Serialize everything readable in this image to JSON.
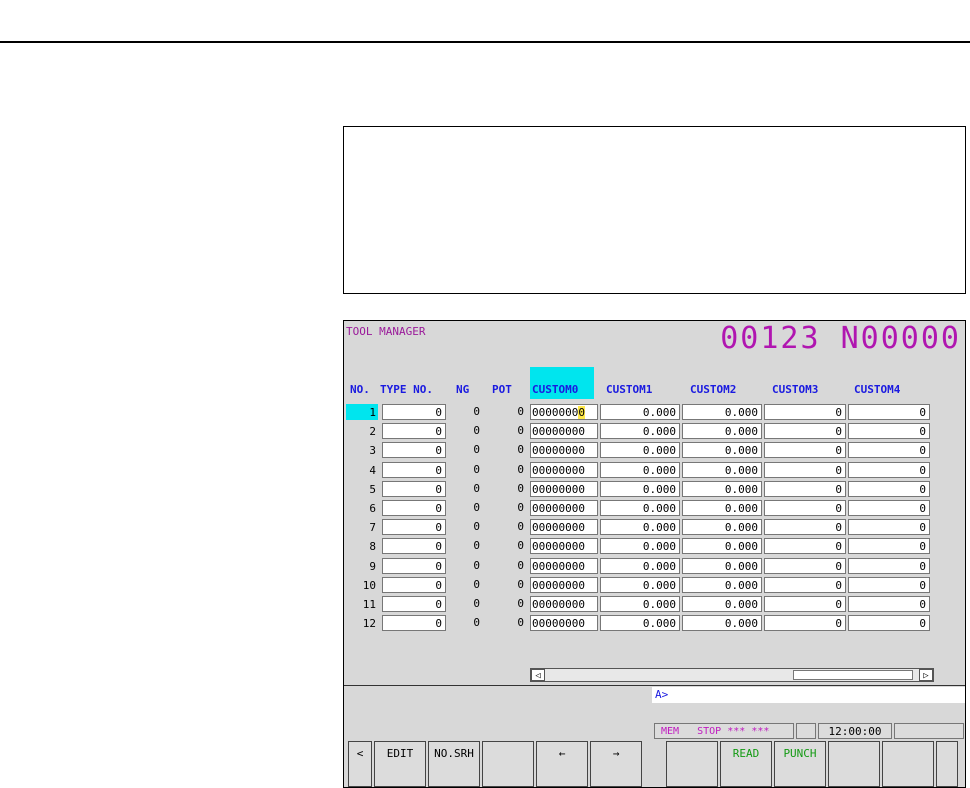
{
  "screen": {
    "title": "TOOL MANAGER",
    "program": "00123 N00000",
    "columns": [
      "NO.",
      "TYPE NO.",
      "NG",
      "POT",
      "CUSTOM0",
      "CUSTOM1",
      "CUSTOM2",
      "CUSTOM3",
      "CUSTOM4"
    ],
    "rows": [
      {
        "no": "1",
        "type": "0",
        "ng": "0",
        "pot": "0",
        "c0": "00000000",
        "c1": "0.000",
        "c2": "0.000",
        "c3": "0",
        "c4": "0"
      },
      {
        "no": "2",
        "type": "0",
        "ng": "0",
        "pot": "0",
        "c0": "00000000",
        "c1": "0.000",
        "c2": "0.000",
        "c3": "0",
        "c4": "0"
      },
      {
        "no": "3",
        "type": "0",
        "ng": "0",
        "pot": "0",
        "c0": "00000000",
        "c1": "0.000",
        "c2": "0.000",
        "c3": "0",
        "c4": "0"
      },
      {
        "no": "4",
        "type": "0",
        "ng": "0",
        "pot": "0",
        "c0": "00000000",
        "c1": "0.000",
        "c2": "0.000",
        "c3": "0",
        "c4": "0"
      },
      {
        "no": "5",
        "type": "0",
        "ng": "0",
        "pot": "0",
        "c0": "00000000",
        "c1": "0.000",
        "c2": "0.000",
        "c3": "0",
        "c4": "0"
      },
      {
        "no": "6",
        "type": "0",
        "ng": "0",
        "pot": "0",
        "c0": "00000000",
        "c1": "0.000",
        "c2": "0.000",
        "c3": "0",
        "c4": "0"
      },
      {
        "no": "7",
        "type": "0",
        "ng": "0",
        "pot": "0",
        "c0": "00000000",
        "c1": "0.000",
        "c2": "0.000",
        "c3": "0",
        "c4": "0"
      },
      {
        "no": "8",
        "type": "0",
        "ng": "0",
        "pot": "0",
        "c0": "00000000",
        "c1": "0.000",
        "c2": "0.000",
        "c3": "0",
        "c4": "0"
      },
      {
        "no": "9",
        "type": "0",
        "ng": "0",
        "pot": "0",
        "c0": "00000000",
        "c1": "0.000",
        "c2": "0.000",
        "c3": "0",
        "c4": "0"
      },
      {
        "no": "10",
        "type": "0",
        "ng": "0",
        "pot": "0",
        "c0": "00000000",
        "c1": "0.000",
        "c2": "0.000",
        "c3": "0",
        "c4": "0"
      },
      {
        "no": "11",
        "type": "0",
        "ng": "0",
        "pot": "0",
        "c0": "00000000",
        "c1": "0.000",
        "c2": "0.000",
        "c3": "0",
        "c4": "0"
      },
      {
        "no": "12",
        "type": "0",
        "ng": "0",
        "pot": "0",
        "c0": "00000000",
        "c1": "0.000",
        "c2": "0.000",
        "c3": "0",
        "c4": "0"
      }
    ],
    "prompt": "A>",
    "status": {
      "mode": "MEM",
      "state": "STOP",
      "stars1": "***",
      "stars2": "***",
      "time": "12:00:00"
    },
    "softkeys": [
      "<",
      "EDIT",
      "NO.SRH",
      "",
      "←",
      "→",
      "",
      "READ",
      "PUNCH",
      "",
      "",
      ""
    ],
    "scroll_left": "◁",
    "scroll_right": "▷"
  },
  "colors": {
    "title": "#9a1a9a",
    "program": "#b016b0",
    "header": "#1a1ae0",
    "highlight": "#00e5ee",
    "softkey_green": "#139a13",
    "status_magenta": "#c01ac0"
  }
}
